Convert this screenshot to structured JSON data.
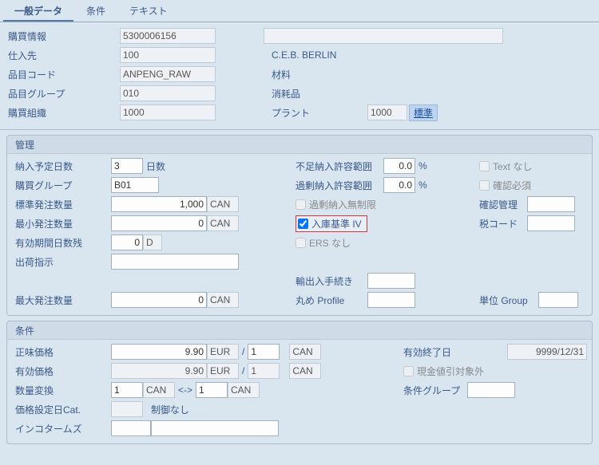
{
  "tabs": {
    "general": "一般データ",
    "conditions": "条件",
    "text": "テキスト"
  },
  "top": {
    "info_label": "購買情報",
    "info_value": "5300006156",
    "vendor_label": "仕入先",
    "vendor_value": "100",
    "vendor_desc": "C.E.B. BERLIN",
    "material_label": "品目コード",
    "material_value": "ANPENG_RAW",
    "material_desc": "材料",
    "matgrp_label": "品目グループ",
    "matgrp_value": "010",
    "matgrp_desc": "消耗品",
    "porg_label": "購買組織",
    "porg_value": "1000",
    "plant_label": "プラント",
    "plant_value": "1000",
    "plant_badge": "標準"
  },
  "mgmt": {
    "title": "管理",
    "pldel_label": "納入予定日数",
    "pldel_value": "3",
    "pldel_unit": "日数",
    "pgrp_label": "購買グループ",
    "pgrp_value": "B01",
    "stdqty_label": "標準発注数量",
    "stdqty_value": "1,000",
    "stdqty_unit": "CAN",
    "minqty_label": "最小発注数量",
    "minqty_value": "0",
    "minqty_unit": "CAN",
    "rem_label": "有効期間日数残",
    "rem_value": "0",
    "rem_unit": "D",
    "ship_label": "出荷指示",
    "maxqty_label": "最大発注数量",
    "maxqty_value": "0",
    "maxqty_unit": "CAN",
    "under_label": "不足納入許容範囲",
    "under_value": "0.0",
    "pct": "%",
    "over_label": "過剰納入許容範囲",
    "over_value": "0.0",
    "unlimited_label": "過剰納入無制限",
    "griv_label": "入庫基準 IV",
    "ers_label": "ERS なし",
    "export_label": "輸出入手続き",
    "round_label": "丸め Profile",
    "textnone_label": "Text なし",
    "confreq_label": "確認必須",
    "confmgmt_label": "確認管理",
    "taxcode_label": "税コード",
    "unitgrp_label": "単位 Group"
  },
  "cond": {
    "title": "条件",
    "net_label": "正味価格",
    "net_value": "9.90",
    "cur": "EUR",
    "per": "1",
    "unit": "CAN",
    "slash": "/",
    "eff_label": "有効価格",
    "eff_value": "9.90",
    "qty_label": "数量変換",
    "qty_from": "1",
    "qty_from_u": "CAN",
    "arrow": "<->",
    "qty_to": "1",
    "qty_to_u": "CAN",
    "pricecat_label": "価格設定日Cat.",
    "pricecat_desc": "制御なし",
    "inco_label": "インコタームズ",
    "validto_label": "有効終了日",
    "validto_value": "9999/12/31",
    "cashd_label": "現金値引対象外",
    "condgrp_label": "条件グループ"
  }
}
